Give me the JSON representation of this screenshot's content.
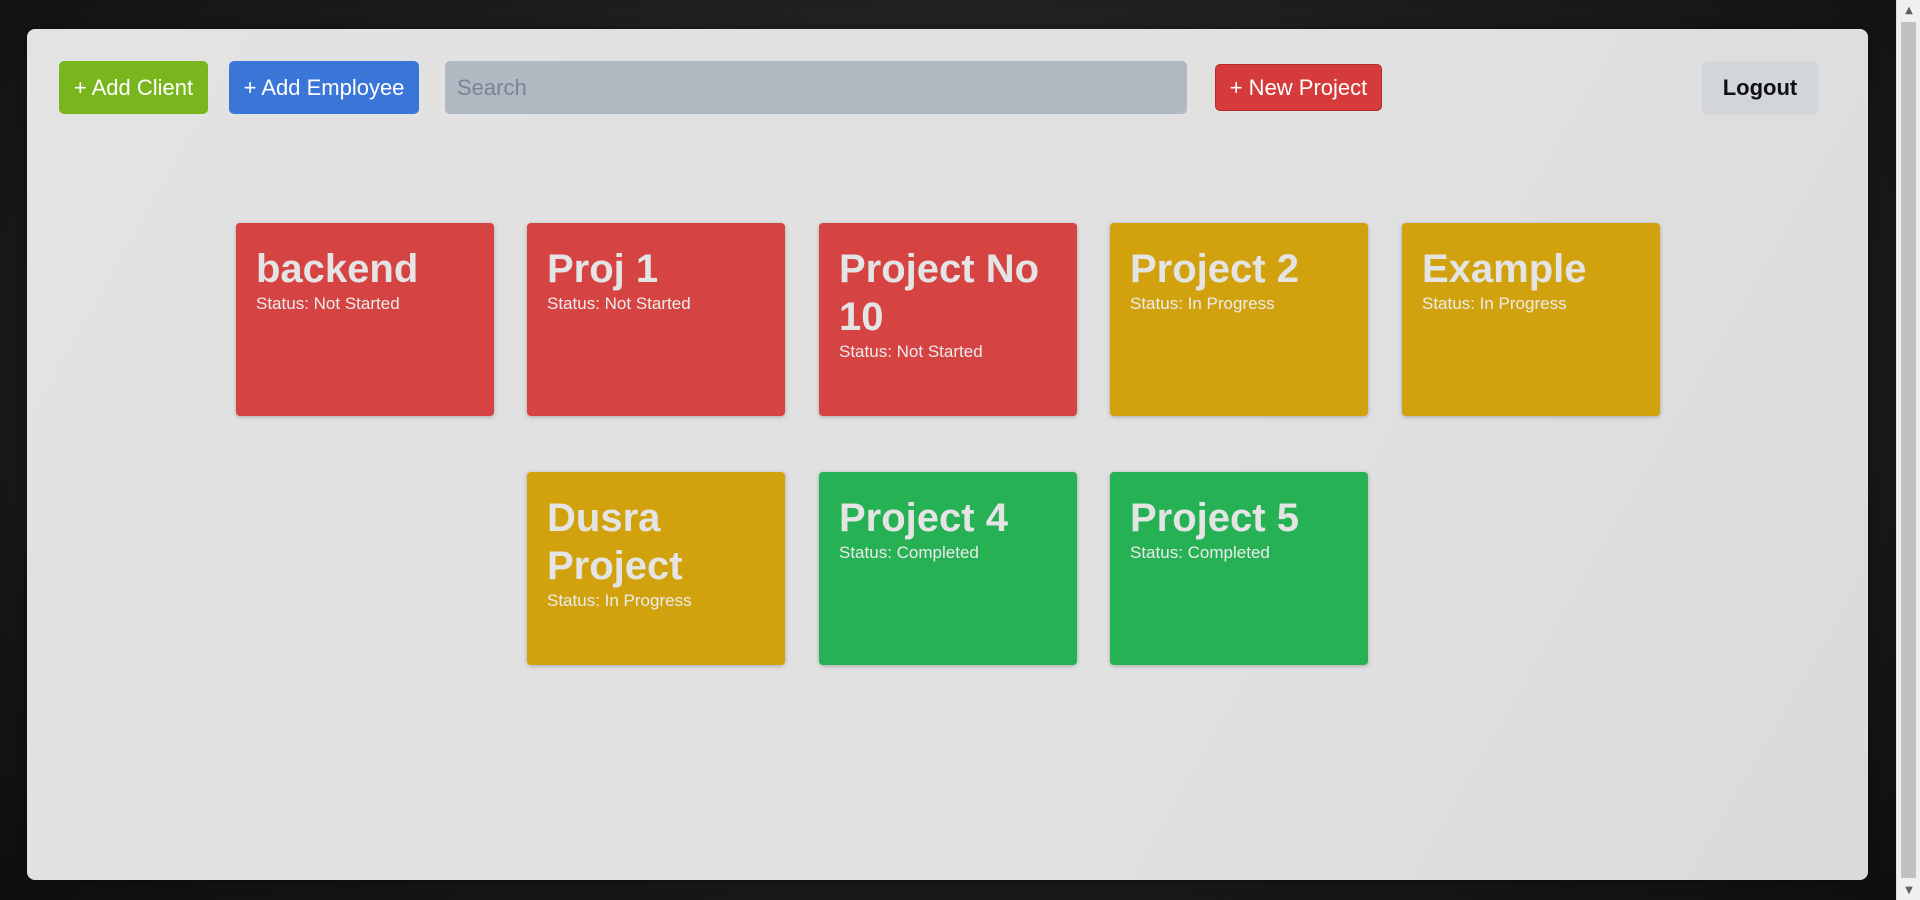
{
  "toolbar": {
    "add_client_label": "+ Add Client",
    "add_employee_label": "+ Add Employee",
    "search_placeholder": "Search",
    "search_value": "",
    "new_project_label": "+ New Project",
    "logout_label": "Logout"
  },
  "colors": {
    "add_client": "#79b51c",
    "add_employee": "#3a76d8",
    "new_project": "#d63b3b",
    "not_started": "#d64343",
    "in_progress": "#d1a20e",
    "completed": "#25b154"
  },
  "projects": [
    {
      "title": "backend",
      "status_prefix": "Status:",
      "status": "Not Started"
    },
    {
      "title": "Proj 1",
      "status_prefix": "Status:",
      "status": "Not Started"
    },
    {
      "title": "Project No 10",
      "status_prefix": "Status:",
      "status": "Not Started"
    },
    {
      "title": "Project 2",
      "status_prefix": "Status:",
      "status": "In Progress"
    },
    {
      "title": "Example",
      "status_prefix": "Status:",
      "status": "In Progress"
    },
    {
      "title": "Dusra Project",
      "status_prefix": "Status:",
      "status": "In Progress"
    },
    {
      "title": "Project 4",
      "status_prefix": "Status:",
      "status": "Completed"
    },
    {
      "title": "Project 5",
      "status_prefix": "Status:",
      "status": "Completed"
    }
  ],
  "scrollbar": {
    "up_icon": "triangle-up",
    "down_icon": "triangle-down"
  }
}
